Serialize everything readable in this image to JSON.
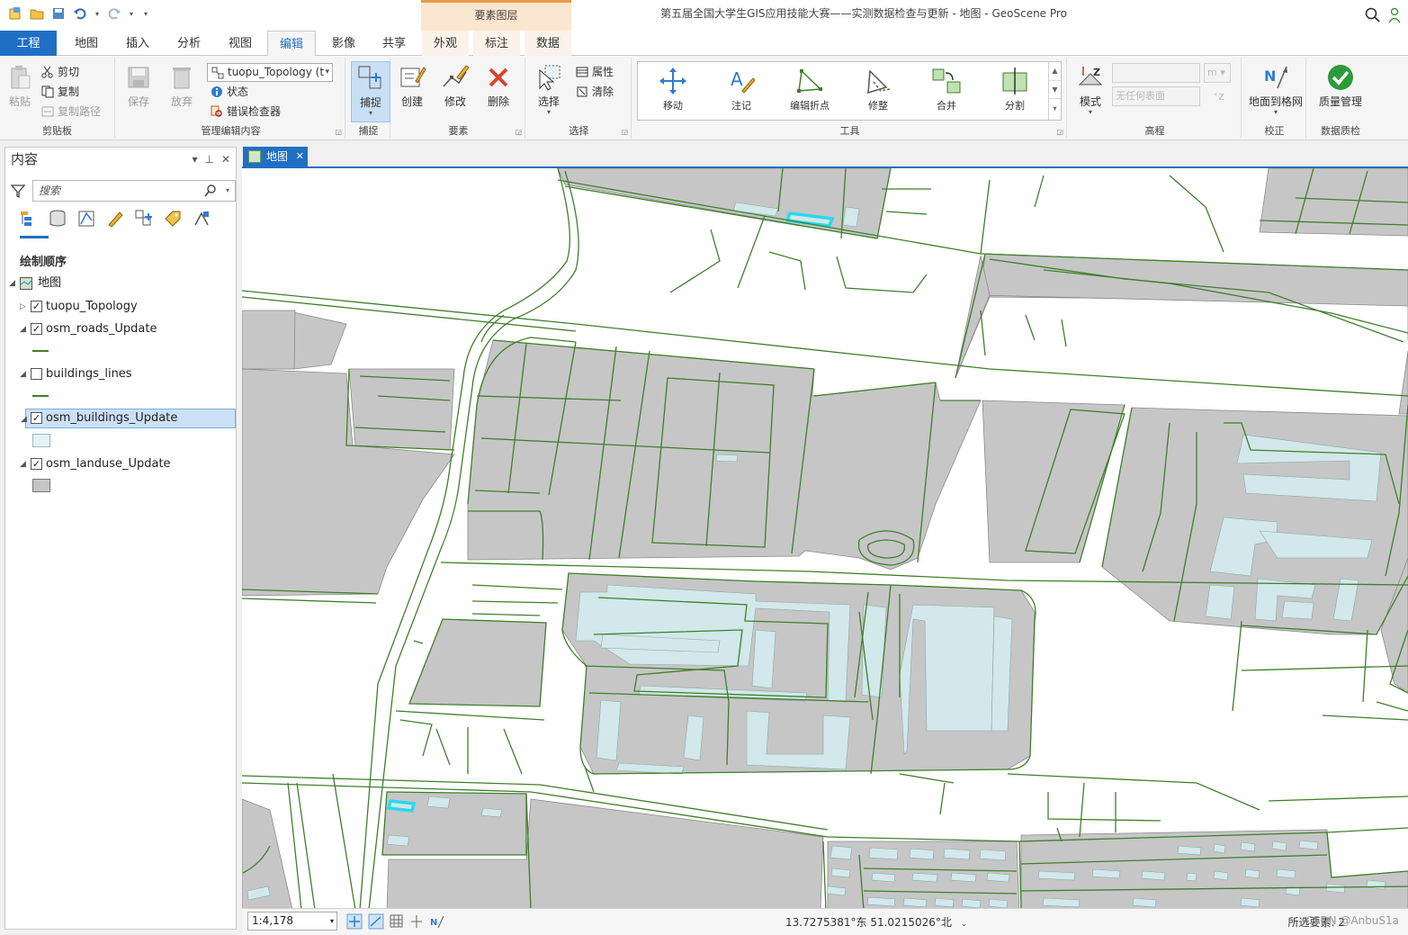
{
  "window": {
    "title": "第五届全国大学生GIS应用技能大赛——实测数据检查与更新 - 地图 - GeoScene Pro",
    "context_group": "要素图层"
  },
  "tabs": [
    {
      "label": "工程"
    },
    {
      "label": "地图"
    },
    {
      "label": "插入"
    },
    {
      "label": "分析"
    },
    {
      "label": "视图"
    },
    {
      "label": "编辑"
    },
    {
      "label": "影像"
    },
    {
      "label": "共享"
    },
    {
      "label": "外观"
    },
    {
      "label": "标注"
    },
    {
      "label": "数据"
    }
  ],
  "ribbon": {
    "clipboard": {
      "label": "剪贴板",
      "paste": "粘贴",
      "cut": "剪切",
      "copy": "复制",
      "copy_path": "复制路径"
    },
    "manage": {
      "label": "管理编辑内容",
      "save": "保存",
      "discard": "放弃",
      "topology": "tuopu_Topology (t",
      "status": "状态",
      "error_inspector": "错误检查器"
    },
    "snapping": {
      "label": "捕捉",
      "snap": "捕捉"
    },
    "features": {
      "label": "要素",
      "create": "创建",
      "modify": "修改",
      "delete": "删除"
    },
    "selection": {
      "label": "选择",
      "select": "选择",
      "attributes": "属性",
      "clear": "清除"
    },
    "tools": {
      "label": "工具",
      "items": [
        "移动",
        "注记",
        "编辑折点",
        "修整",
        "合并",
        "分割"
      ]
    },
    "elevation": {
      "label": "高程",
      "mode": "模式",
      "surface_placeholder": "无任何表面",
      "unit": "m"
    },
    "correction": {
      "label": "校正",
      "ground_to_grid": "地面到格网"
    },
    "quality": {
      "label": "数据质检",
      "quality_mgmt": "质量管理"
    }
  },
  "contents": {
    "title": "内容",
    "search_placeholder": "搜索",
    "draw_order": "绘制顺序",
    "map_name": "地图",
    "layers": [
      {
        "name": "tuopu_Topology",
        "checked": true,
        "expanded": false
      },
      {
        "name": "osm_roads_Update",
        "checked": true,
        "expanded": true
      },
      {
        "name": "buildings_lines",
        "checked": false,
        "expanded": true
      },
      {
        "name": "osm_buildings_Update",
        "checked": true,
        "expanded": true,
        "selected": true
      },
      {
        "name": "osm_landuse_Update",
        "checked": true,
        "expanded": true
      }
    ]
  },
  "map_view": {
    "tab_label": "地图",
    "colors": {
      "road": "#3f7f2a",
      "landuse": "#c6c6c6",
      "building": "#d2e8ea",
      "building_selected": "#27d9ee",
      "outline": "#777777"
    }
  },
  "statusbar": {
    "scale": "1:4,178",
    "coordinates": "13.7275381°东 51.0215026°北",
    "selected_features": "所选要素: 2",
    "watermark": "CSDN @AnbuS1a"
  }
}
